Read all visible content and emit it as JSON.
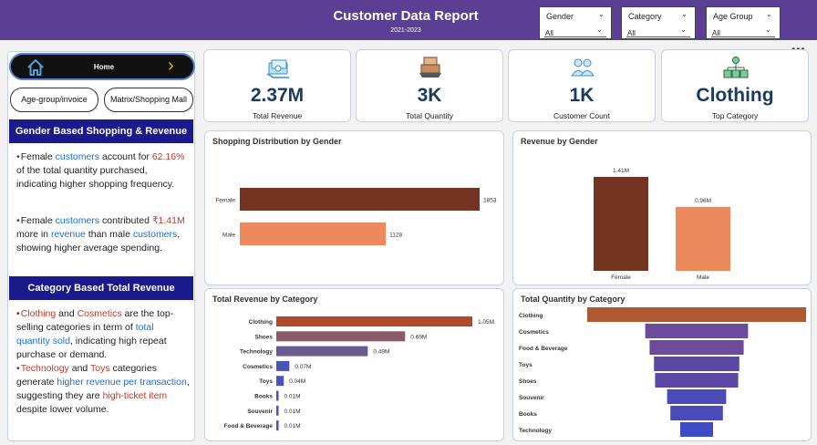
{
  "header": {
    "title": "Customer Data Report",
    "subtitle": "2021-2023",
    "filters": [
      {
        "label": "Gender",
        "value": "All"
      },
      {
        "label": "Category",
        "value": "All"
      },
      {
        "label": "Age Group",
        "value": "All"
      }
    ],
    "more": "•••"
  },
  "nav": {
    "home": "Home",
    "buttons": [
      "Age-group/invoice",
      "Matrix/Shopping Mall"
    ]
  },
  "sections": {
    "gender_title": "Gender Based Shopping & Revenue",
    "category_title": "Category Based Total Revenue",
    "g1": [
      "Female ",
      "customers",
      " account for ",
      "62.16%",
      " of the total quantity purchased, indicating higher shopping frequency."
    ],
    "g2": [
      "Female ",
      "customers",
      " contributed ",
      "₹1.41M",
      " more in ",
      "revenue",
      " than male ",
      "customers",
      ", showing higher average spending."
    ],
    "c1": [
      "Clothing",
      " and ",
      "Cosmetics",
      " are the top-selling categories in term of ",
      "total quantity sold",
      ", indicating high repeat purchase or demand."
    ],
    "c2": [
      "Technology",
      " and ",
      "Toys",
      " categories generate ",
      "higher revenue per transaction",
      ", suggesting they are ",
      "high-ticket item",
      " despite lower volume."
    ]
  },
  "kpis": [
    {
      "value": "2.37M",
      "label": "Total Revenue",
      "icon": "money-stack-icon"
    },
    {
      "value": "3K",
      "label": "Total Quantity",
      "icon": "boxes-icon"
    },
    {
      "value": "1K",
      "label": "Customer Count",
      "icon": "customers-icon"
    },
    {
      "value": "Clothing",
      "label": "Top Category",
      "icon": "category-network-icon"
    }
  ],
  "colors": {
    "header": "#5b3f95",
    "female": "#733520",
    "male": "#ec8a5e",
    "navy": "#1a1a8c",
    "kpi_text": "#1b3a5c"
  },
  "chart_data": [
    {
      "title": "Shopping Distribution by Gender",
      "type": "bar",
      "orientation": "horizontal",
      "categories": [
        "Female",
        "Male"
      ],
      "values": [
        1853,
        1128
      ],
      "labels": [
        "1853",
        "1128"
      ]
    },
    {
      "title": "Revenue by Gender",
      "type": "bar",
      "orientation": "vertical",
      "categories": [
        "Female",
        "Male"
      ],
      "values": [
        1.41,
        0.96
      ],
      "labels": [
        "1.41M",
        "0.96M"
      ]
    },
    {
      "title": "Total Revenue by Category",
      "type": "bar",
      "orientation": "horizontal",
      "categories": [
        "Clothing",
        "Shoes",
        "Technology",
        "Cosmetics",
        "Toys",
        "Books",
        "Souvenir",
        "Food & Beverage"
      ],
      "values": [
        1.05,
        0.69,
        0.49,
        0.07,
        0.04,
        0.01,
        0.01,
        0.01
      ],
      "labels": [
        "1.05M",
        "0.69M",
        "0.49M",
        "0.07M",
        "0.04M",
        "0.01M",
        "0.01M",
        "0.01M"
      ]
    },
    {
      "title": "Total Quantity by Category",
      "type": "funnel",
      "categories": [
        "Clothing",
        "Cosmetics",
        "Food & Beverage",
        "Toys",
        "Shoes",
        "Souvenir",
        "Books",
        "Technology"
      ],
      "values": [
        1000,
        470,
        430,
        390,
        380,
        270,
        240,
        150
      ]
    }
  ]
}
